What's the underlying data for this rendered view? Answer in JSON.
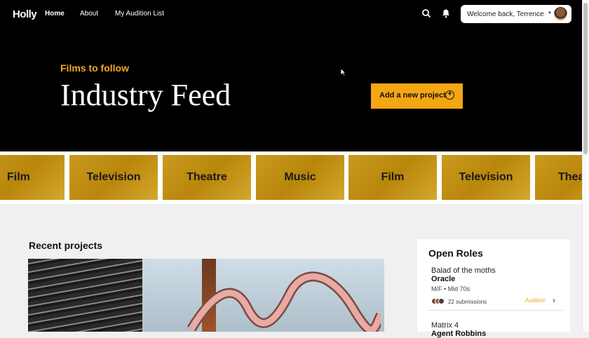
{
  "nav": {
    "logo": "Holly",
    "links": [
      {
        "label": "Home"
      },
      {
        "label": "About"
      },
      {
        "label": "My Audition List"
      }
    ],
    "welcome": "Welcome back, Terrence"
  },
  "hero": {
    "subtitle": "Films to follow",
    "title": "Industry Feed",
    "add_button": "Add a new project"
  },
  "categories": [
    "Film",
    "Television",
    "Theatre",
    "Music",
    "Film",
    "Television",
    "Thea"
  ],
  "recent": {
    "title": "Recent projects"
  },
  "open_roles": {
    "title": "Open Roles",
    "roles": [
      {
        "project": "Balad of the moths",
        "role": "Oracle",
        "meta": "M/F • Mid 70s",
        "submissions": "22 submissions",
        "action": "Audition"
      },
      {
        "project": "Matrix 4",
        "role": "Agent Robbins"
      }
    ]
  }
}
